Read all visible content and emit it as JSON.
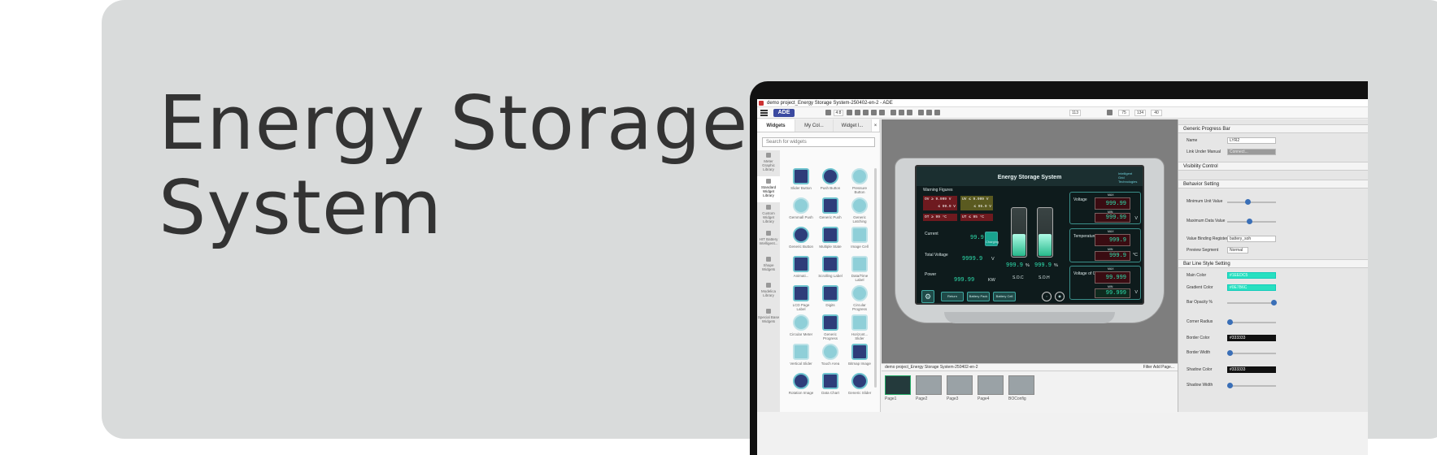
{
  "hero": {
    "line1": "Energy Storage",
    "line2": "System"
  },
  "window": {
    "title": "demo project_Energy Storage System-250402-en-2 - ADE"
  },
  "toolbar": {
    "f1": "4:8",
    "f2": "113",
    "f3": "75",
    "f4": "134",
    "f5": "40"
  },
  "left_panel": {
    "tabs": [
      "Widgets",
      "My Col...",
      "Widget l..."
    ],
    "search_placeholder": "Search for widgets",
    "libraries": [
      "Meter Graphic Library",
      "Standard Widget Library",
      "Custom Widget Library",
      "HIT Battery Intelligent...",
      "Shape Widgets",
      "Modelica Library",
      "Special Base Widgets"
    ],
    "widgets": [
      "Slider Button",
      "Push Button",
      "Pressure Button",
      "Gemmall Push",
      "Generic Push",
      "Generic Latching",
      "Generic Button",
      "Multiple State",
      "Image Cell",
      "Animati...",
      "Scrolling Label",
      "Data/Time Label",
      "LCD Page Label",
      "Digits",
      "Circular Progress",
      "Circular Meter",
      "Generic Progress",
      "Horizont... Slider",
      "Vertical Slider",
      "Touch Area",
      "Bitmap Image",
      "Rotation Image",
      "Data Chart",
      "Generic Slider"
    ]
  },
  "hmi": {
    "title": "Energy Storage System",
    "logo_text": "Intelligent Grid Technologies",
    "warning_title": "Warning Figures",
    "warnings": [
      "OV ≥ 9.999 V",
      "≤ 99.9 V",
      "UV ≤ 9.999 V",
      "≤ 95.9 V",
      "OT ≥ 99 °C",
      "UT ≤ 95 °C"
    ],
    "current_label": "Current",
    "current_val": "99.9",
    "current_unit": "A",
    "charge_label": "Charging",
    "total_v_label": "Total Voltage",
    "total_v_val": "9999.9",
    "total_v_unit": "V",
    "power_label": "Power",
    "power_val": "999.99",
    "power_unit": "KW",
    "soc_val": "999.9",
    "soc_unit": "%",
    "soc_label": "S.O.C",
    "soh_val": "999.9",
    "soh_unit": "%",
    "soh_label": "S.O.H",
    "voltage_label": "Voltage",
    "v_max_label": "MAX",
    "v_max": "999.99",
    "v_min_label": "MIN",
    "v_min": "999.99",
    "v_unit": "V",
    "temp_label": "Temperature",
    "t_max_label": "MAX",
    "t_max": "999.9",
    "t_min_label": "MIN",
    "t_min": "999.9",
    "t_unit": "°C",
    "cell_label": "Voltage of Cell",
    "c_max_label": "MAX",
    "c_max": "99.999",
    "c_min_label": "MIN",
    "c_min": "99.999",
    "c_unit": "V",
    "buttons": [
      "Return",
      "Battery Pack",
      "Battery Cell"
    ],
    "battery_level": 0.45
  },
  "statusbar": {
    "path": "demo project_Energy Storage System-250402-en-2",
    "right": "Filter  Add Page..."
  },
  "pages": [
    "Page1",
    "Page2",
    "Page3",
    "Page4",
    "BOConfig"
  ],
  "props": {
    "sec1": "Generic Progress Bar",
    "name_label": "Name",
    "name_val": "LYR2",
    "link_label": "Link Under Manual",
    "link_val": "Connect...",
    "sec2": "Visibility Control",
    "sec3": "Behavior Setting",
    "min_label": "Minimum Unit Value",
    "max_label": "Maximum Data Value",
    "bind_label": "Value Binding Register",
    "bind_val": "battery_soh",
    "preview_label": "Preview Segment",
    "preview_val": "Normal",
    "sec4": "Bar Line Style Setting",
    "color_label": "Main Color",
    "color_val": "#1EEDC5",
    "grad_label": "Gradient Color",
    "grad_val": "#0E7B6C",
    "opacity_label": "Bar Opacity %",
    "corner_label": "Corner Radius",
    "border_label": "Border Color",
    "border_val": "#333333",
    "bwidth_label": "Border Width",
    "shadow_label": "Shadow Color",
    "shadow_val": "#333333",
    "swidth_label": "Shadow Width"
  },
  "colors": {
    "banner_bg": "#d9dbdb",
    "hero_text": "#333333",
    "accent": "#2fe2b0"
  }
}
